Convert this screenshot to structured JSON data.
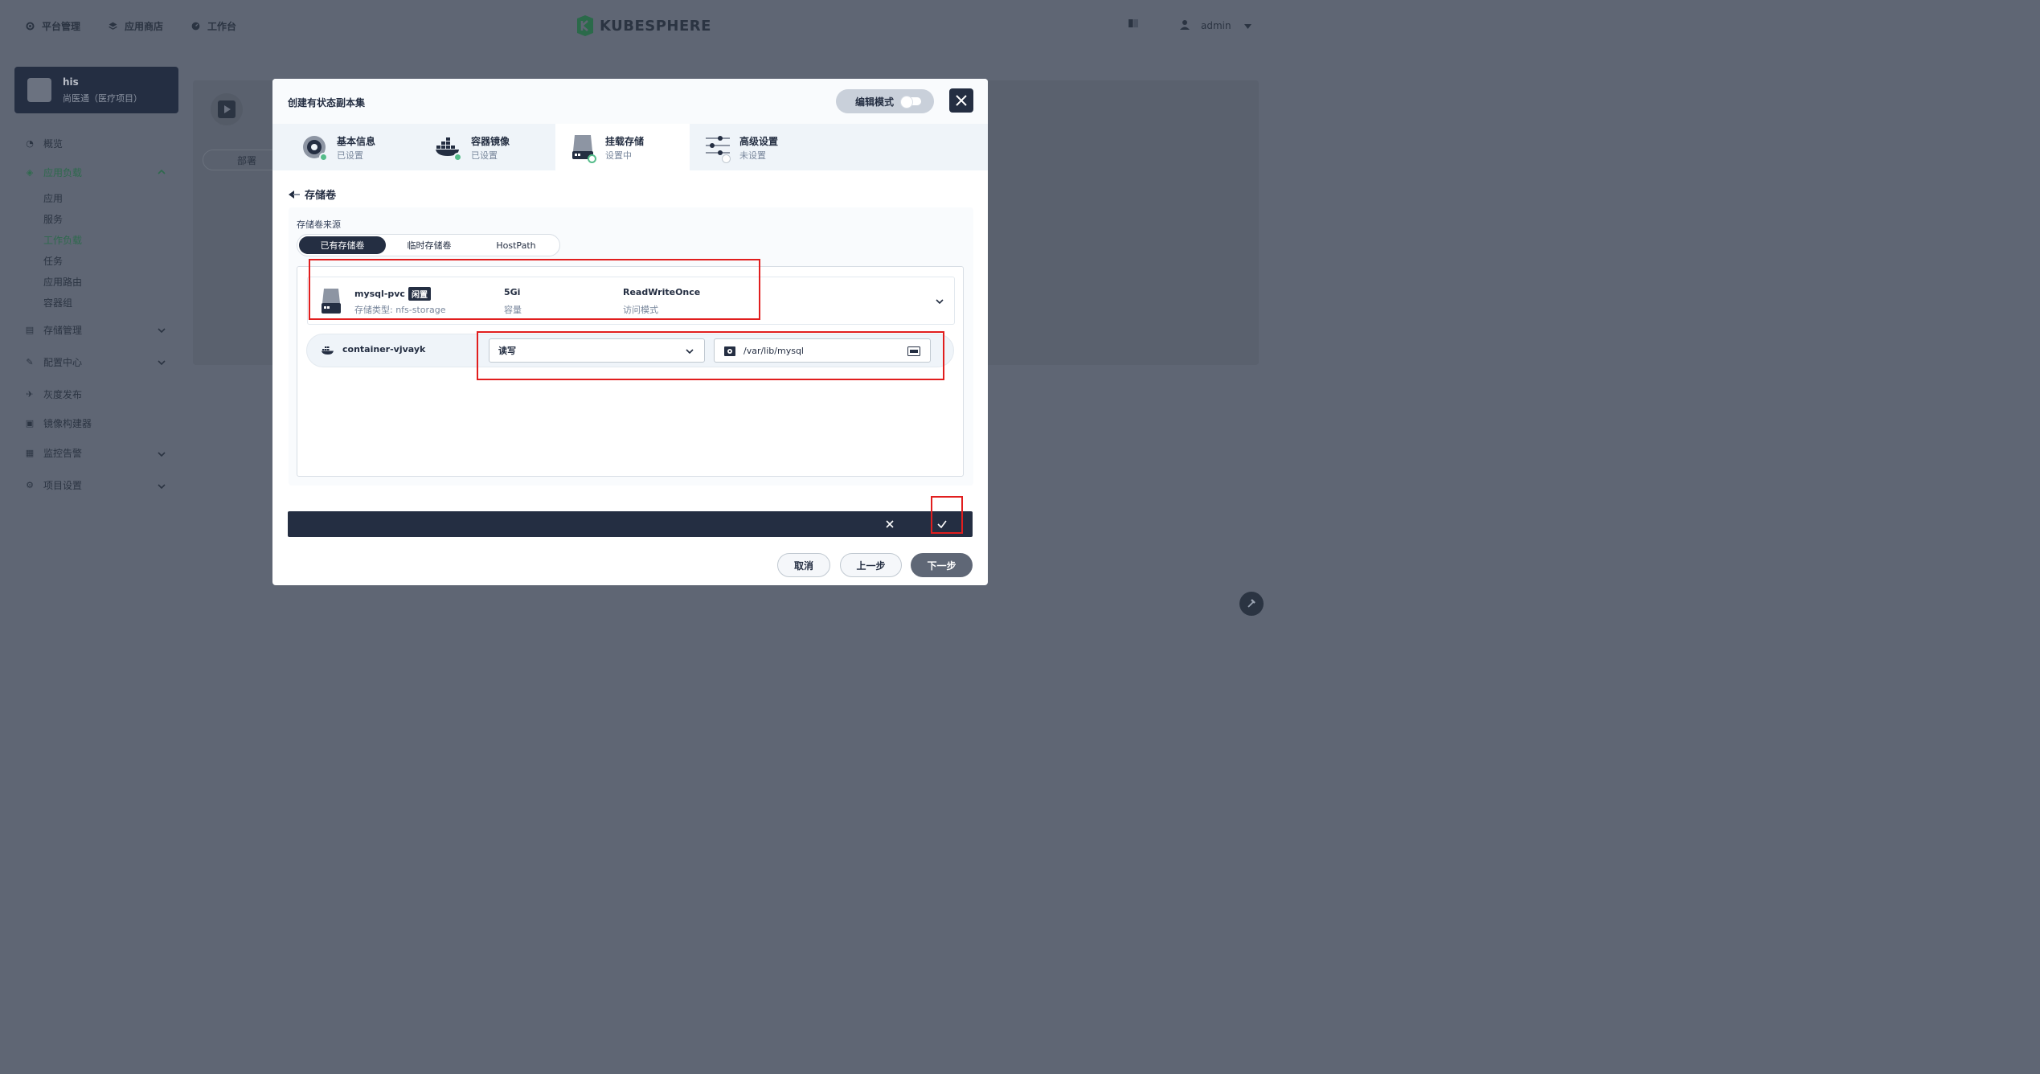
{
  "topnav": {
    "platform": "平台管理",
    "appstore": "应用商店",
    "workbench": "工作台",
    "logo_text": "KUBESPHERE",
    "user": "admin"
  },
  "sidebar": {
    "project_name": "his",
    "project_desc": "尚医通（医疗项目）",
    "items": {
      "overview": "概览",
      "app_workload": "应用负载",
      "storage": "存储管理",
      "config": "配置中心",
      "gray": "灰度发布",
      "image_builder": "镜像构建器",
      "monitoring": "监控告警",
      "project_settings": "项目设置"
    },
    "subitems": {
      "apps": "应用",
      "services": "服务",
      "workloads": "工作负载",
      "jobs": "任务",
      "routes": "应用路由",
      "pods": "容器组"
    }
  },
  "background": {
    "tab": "部署"
  },
  "modal": {
    "title": "创建有状态副本集",
    "edit_mode": "编辑模式",
    "steps": [
      {
        "label": "基本信息",
        "status": "已设置"
      },
      {
        "label": "容器镜像",
        "status": "已设置"
      },
      {
        "label": "挂载存储",
        "status": "设置中"
      },
      {
        "label": "高级设置",
        "status": "未设置"
      }
    ],
    "section_title": "存储卷",
    "volume_source_label": "存储卷来源",
    "source_tabs": [
      "已有存储卷",
      "临时存储卷",
      "HostPath"
    ],
    "volume": {
      "name": "mysql-pvc",
      "badge": "闲置",
      "storage_class": "存储类型: nfs-storage",
      "capacity": "5Gi",
      "capacity_label": "容量",
      "access_mode": "ReadWriteOnce",
      "access_mode_label": "访问模式"
    },
    "mount": {
      "container": "container-vjvayk",
      "mode": "读写",
      "path": "/var/lib/mysql"
    },
    "footer": {
      "cancel": "取消",
      "prev": "上一步",
      "next": "下一步"
    }
  },
  "colors": {
    "primary_dark": "#242e42",
    "success": "#55bc8a",
    "annotation_red": "#e11e1e"
  }
}
